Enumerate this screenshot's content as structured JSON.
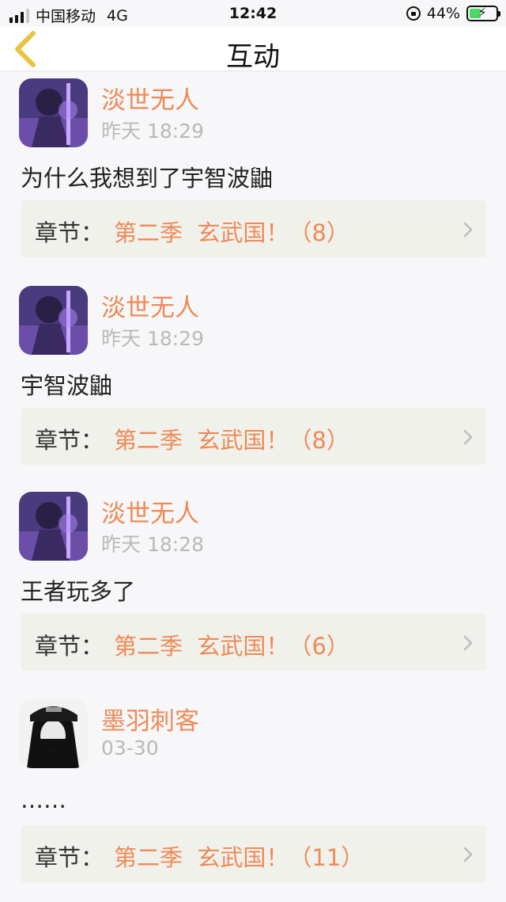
{
  "status_bar": {
    "carrier": "中国移动",
    "network": "4G",
    "time": "12:42",
    "battery": "44%",
    "battery_level": 0.44,
    "signal_bars": 3
  },
  "nav": {
    "title": "互动",
    "back_icon": "chevron-left-icon"
  },
  "colors": {
    "accent": "#ee8a56",
    "back_icon": "#e8c440",
    "chapter_bg": "#f1f1ec"
  },
  "posts": [
    {
      "username": "淡世无人",
      "time": "昨天 18:29",
      "content": "为什么我想到了宇智波鼬",
      "chapter_label": "章节：",
      "chapter_name": "第二季  玄武国！（8）"
    },
    {
      "username": "淡世无人",
      "time": "昨天 18:29",
      "content": "宇智波鼬",
      "chapter_label": "章节：",
      "chapter_name": "第二季  玄武国！（8）"
    },
    {
      "username": "淡世无人",
      "time": "昨天 18:28",
      "content": "王者玩多了",
      "chapter_label": "章节：",
      "chapter_name": "第二季  玄武国！（6）"
    },
    {
      "username": "墨羽刺客",
      "time": "03-30",
      "content": "……",
      "chapter_label": "章节：",
      "chapter_name": "第二季  玄武国！（11）"
    }
  ]
}
